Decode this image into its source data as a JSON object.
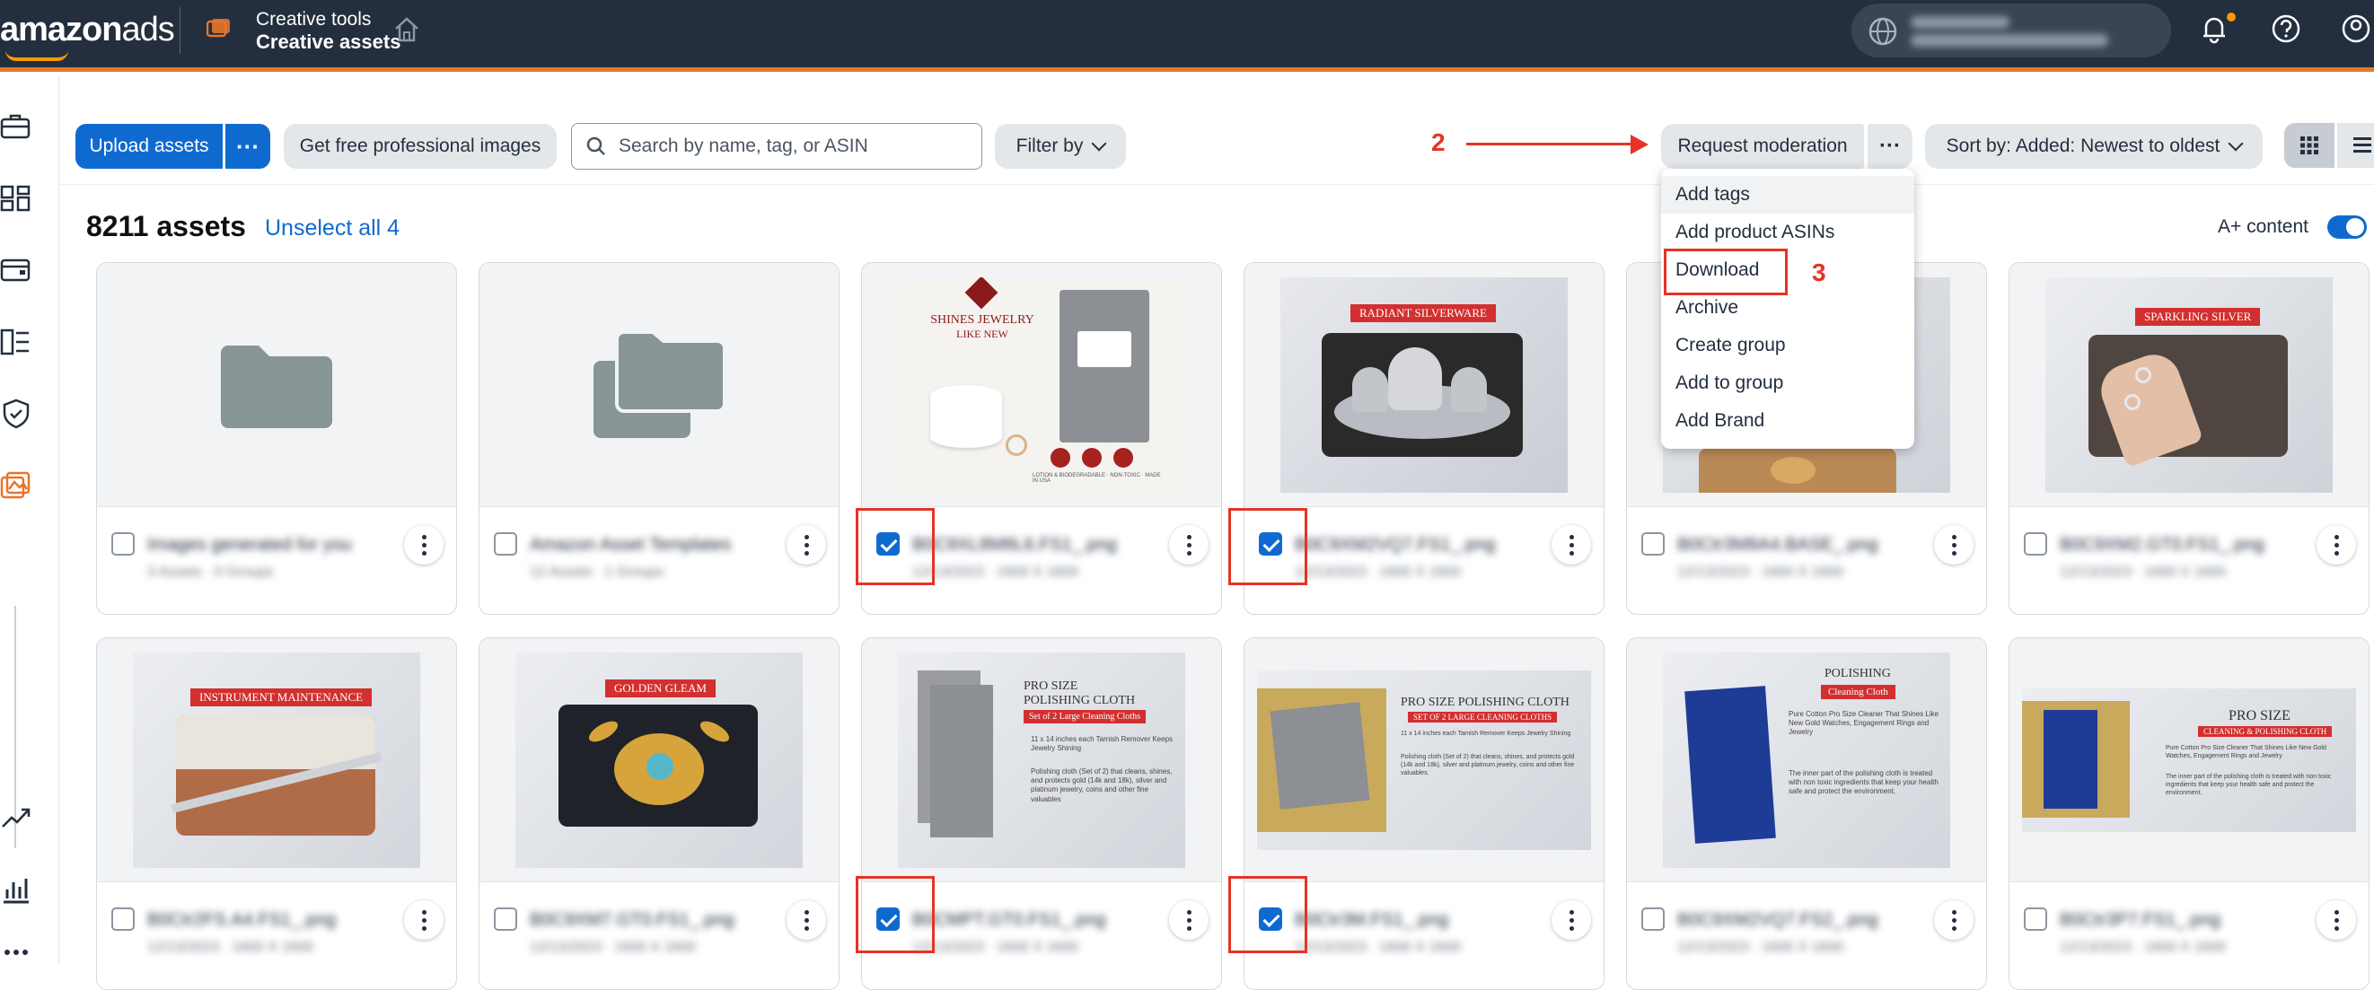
{
  "header": {
    "logo_text": "amazon",
    "logo_suffix": "ads",
    "breadcrumb_top": "Creative tools",
    "breadcrumb_main": "Creative assets",
    "accent_color": "#e8742c"
  },
  "toolbar": {
    "upload_label": "Upload assets",
    "upload_more_label": "···",
    "free_images_label": "Get free professional images",
    "search_placeholder": "Search by name, tag, or ASIN",
    "filter_label": "Filter by",
    "request_moderation_label": "Request moderation",
    "more_label": "···",
    "sort_label": "Sort by: Added: Newest to oldest"
  },
  "annotations": {
    "step2": "2",
    "step3": "3",
    "color": "#e53425"
  },
  "summary": {
    "count": "8211 assets",
    "unselect": "Unselect all 4",
    "aplus_label": "A+ content"
  },
  "dropdown": {
    "items": [
      "Add tags",
      "Add product ASINs",
      "Download",
      "Archive",
      "Create group",
      "Add to group",
      "Add Brand"
    ]
  },
  "cards": [
    {
      "name": "Images generated for you",
      "meta": "3 Assets · 0 Groups",
      "checked": false,
      "type": "folder"
    },
    {
      "name": "Amazon Asset Templates",
      "meta": "12 Assets · 1 Groups",
      "checked": false,
      "type": "folders"
    },
    {
      "name": "B0C9XL8M8L6.FS1_.png",
      "meta": "12/13/2023 · 1600 X 1600",
      "checked": true,
      "type": "image",
      "caption": "SHINES JEWELRY LIKE NEW"
    },
    {
      "name": "B0C9XM2VQ7.FS1_.png",
      "meta": "12/13/2023 · 1600 X 1600",
      "checked": true,
      "type": "image",
      "caption": "RADIANT SILVERWARE"
    },
    {
      "name": "B0Ctr3M8A4.BASE_.png",
      "meta": "12/13/2023 · 1600 X 1600",
      "checked": false,
      "type": "image",
      "caption": ""
    },
    {
      "name": "B0C9XM2.GT0.FS1_.png",
      "meta": "12/13/2023 · 1600 X 1600",
      "checked": false,
      "type": "image",
      "caption": "SPARKLING SILVER"
    },
    {
      "name": "B0Ctr2FS.A4.FS1_.png",
      "meta": "12/13/2023 · 1600 X 1600",
      "checked": false,
      "type": "image",
      "caption": "INSTRUMENT MAINTENANCE"
    },
    {
      "name": "B0C9XM7.GT0.FS1_.png",
      "meta": "12/13/2023 · 1600 X 1600",
      "checked": false,
      "type": "image",
      "caption": "GOLDEN GLEAM"
    },
    {
      "name": "B0CMPT.GT0.FS1_.png",
      "meta": "12/13/2023 · 1600 X 1600",
      "checked": true,
      "type": "image",
      "caption": "PRO SIZE POLISHING CLOTH"
    },
    {
      "name": "B0Ctr3M.FS1_.png",
      "meta": "12/13/2023 · 1600 X 1600",
      "checked": true,
      "type": "image",
      "caption": "PRO SIZE POLISHING CLOTH"
    },
    {
      "name": "B0C9XM2VQ7.FS2_.png",
      "meta": "12/13/2023 · 1600 X 1600",
      "checked": false,
      "type": "image",
      "caption": "POLISHING"
    },
    {
      "name": "B0Ctr3P7.FS1_.png",
      "meta": "12/13/2023 · 1600 X 1600",
      "checked": false,
      "type": "image",
      "caption": "PRO SIZE"
    }
  ],
  "images": {
    "c3_brand": "SHINES JEWELRY",
    "c3_sub": "LIKE NEW",
    "c3_badges": "LOTION & BIODEGRADABLE · NON-TOXIC · MADE IN USA",
    "c4_banner": "RADIANT SILVERWARE",
    "c6_banner": "SPARKLING SILVER",
    "c7_banner": "INSTRUMENT MAINTENANCE",
    "c8_banner": "GOLDEN GLEAM",
    "c9_title1": "PRO SIZE",
    "c9_title2": "POLISHING CLOTH",
    "c9_banner": "Set of 2 Large Cleaning Cloths",
    "c9_body1": "11 x 14 inches each Tarnish Remover Keeps Jewelry Shining",
    "c9_body2": "Polishing cloth (Set of 2) that cleans, shines, and protects gold (14k and 18k), silver and platinum jewelry, coins and other fine valuables",
    "c10_title": "PRO SIZE POLISHING CLOTH",
    "c10_banner": "SET OF 2 LARGE CLEANING CLOTHS",
    "c10_body1": "11 x 14 inches each Tarnish Remover Keeps Jewelry Shining",
    "c10_body2": "Polishing cloth (Set of 2) that cleans, shines, and protects gold (14k and 18k), silver and platinum jewelry, coins and other fine valuables.",
    "c11_title": "POLISHING",
    "c11_banner": "Cleaning Cloth",
    "c11_body1": "Pure Cotton Pro Size Cleaner That Shines Like New Gold Watches, Engagement Rings and Jewelry",
    "c11_body2": "The inner part of the polishing cloth is treated with non toxic ingredients that keep your health safe and protect the environment.",
    "c12_title": "PRO SIZE",
    "c12_banner": "CLEANING & POLISHING CLOTH",
    "c12_body1": "Pure Cotton Pro Size Cleaner That Shines Like New Gold Watches, Engagement Rings and Jewelry",
    "c12_body2": "The inner part of the polishing cloth is treated with non toxic ingredients that keep your health safe and protect the environment."
  }
}
